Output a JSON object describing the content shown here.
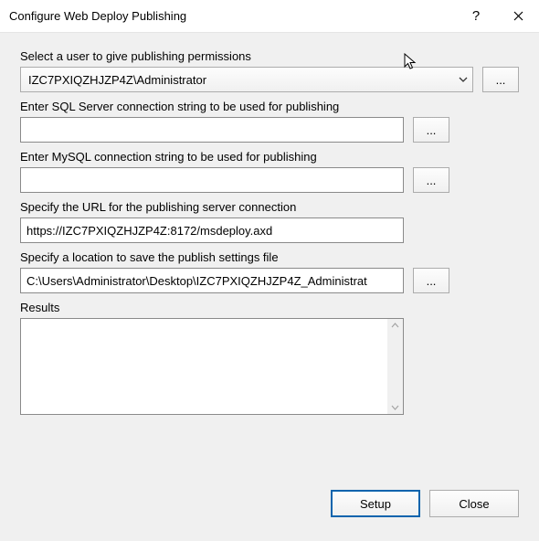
{
  "titlebar": {
    "title": "Configure Web Deploy Publishing",
    "help": "?"
  },
  "labels": {
    "select_user": "Select a user to give publishing permissions",
    "sql_conn": "Enter SQL Server connection string to be used for publishing",
    "mysql_conn": "Enter MySQL connection string to be used for publishing",
    "url": "Specify the URL for the publishing server connection",
    "save_loc": "Specify a location to save the publish settings file",
    "results": "Results"
  },
  "fields": {
    "user_selected": "IZC7PXIQZHJZP4Z\\Administrator",
    "sql_value": "",
    "mysql_value": "",
    "url_value": "https://IZC7PXIQZHJZP4Z:8172/msdeploy.axd",
    "save_value": "C:\\Users\\Administrator\\Desktop\\IZC7PXIQZHJZP4Z_Administrat"
  },
  "buttons": {
    "browse": "...",
    "setup": "Setup",
    "close": "Close"
  }
}
